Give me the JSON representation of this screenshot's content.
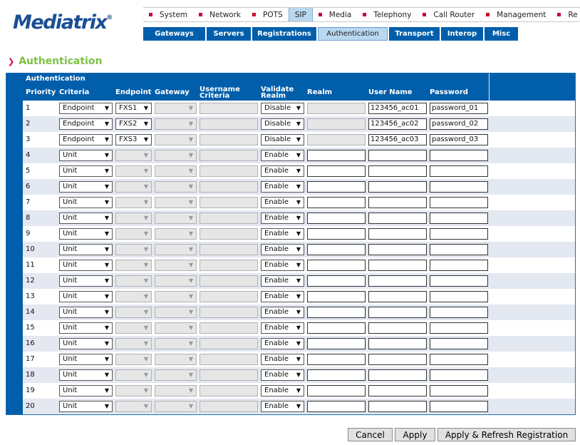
{
  "logo": {
    "name": "Mediatrix",
    "mark": "®"
  },
  "topnav": [
    {
      "label": "System",
      "active": false
    },
    {
      "label": "Network",
      "active": false
    },
    {
      "label": "POTS",
      "active": false
    },
    {
      "label": "SIP",
      "active": true
    },
    {
      "label": "Media",
      "active": false
    },
    {
      "label": "Telephony",
      "active": false
    },
    {
      "label": "Call Router",
      "active": false
    },
    {
      "label": "Management",
      "active": false
    },
    {
      "label": "Re",
      "active": false
    }
  ],
  "subnav": [
    {
      "label": "Gateways",
      "active": false
    },
    {
      "label": "Servers",
      "active": false
    },
    {
      "label": "Registrations",
      "active": false
    },
    {
      "label": "Authentication",
      "active": true
    },
    {
      "label": "Transport",
      "active": false
    },
    {
      "label": "Interop",
      "active": false
    },
    {
      "label": "Misc",
      "active": false
    }
  ],
  "page_title": "Authentication",
  "table": {
    "group_label": "Authentication",
    "columns": {
      "priority": "Priority",
      "criteria": "Criteria",
      "endpoint": "Endpoint",
      "gateway": "Gateway",
      "username_criteria_1": "Username",
      "username_criteria_2": "Criteria",
      "validate_realm_1": "Validate",
      "validate_realm_2": "Realm",
      "realm": "Realm",
      "user_name": "User Name",
      "password": "Password"
    },
    "rows": [
      {
        "priority": "1",
        "criteria": "Endpoint",
        "endpoint": "FXS1",
        "gateway": "",
        "username_criteria": "",
        "validate_realm": "Disable",
        "realm": "",
        "user_name": "123456_ac01",
        "password": "password_01"
      },
      {
        "priority": "2",
        "criteria": "Endpoint",
        "endpoint": "FXS2",
        "gateway": "",
        "username_criteria": "",
        "validate_realm": "Disable",
        "realm": "",
        "user_name": "123456_ac02",
        "password": "password_02"
      },
      {
        "priority": "3",
        "criteria": "Endpoint",
        "endpoint": "FXS3",
        "gateway": "",
        "username_criteria": "",
        "validate_realm": "Disable",
        "realm": "",
        "user_name": "123456_ac03",
        "password": "password_03"
      },
      {
        "priority": "4",
        "criteria": "Unit",
        "endpoint": "",
        "gateway": "",
        "username_criteria": "",
        "validate_realm": "Enable",
        "realm": "",
        "user_name": "",
        "password": ""
      },
      {
        "priority": "5",
        "criteria": "Unit",
        "endpoint": "",
        "gateway": "",
        "username_criteria": "",
        "validate_realm": "Enable",
        "realm": "",
        "user_name": "",
        "password": ""
      },
      {
        "priority": "6",
        "criteria": "Unit",
        "endpoint": "",
        "gateway": "",
        "username_criteria": "",
        "validate_realm": "Enable",
        "realm": "",
        "user_name": "",
        "password": ""
      },
      {
        "priority": "7",
        "criteria": "Unit",
        "endpoint": "",
        "gateway": "",
        "username_criteria": "",
        "validate_realm": "Enable",
        "realm": "",
        "user_name": "",
        "password": ""
      },
      {
        "priority": "8",
        "criteria": "Unit",
        "endpoint": "",
        "gateway": "",
        "username_criteria": "",
        "validate_realm": "Enable",
        "realm": "",
        "user_name": "",
        "password": ""
      },
      {
        "priority": "9",
        "criteria": "Unit",
        "endpoint": "",
        "gateway": "",
        "username_criteria": "",
        "validate_realm": "Enable",
        "realm": "",
        "user_name": "",
        "password": ""
      },
      {
        "priority": "10",
        "criteria": "Unit",
        "endpoint": "",
        "gateway": "",
        "username_criteria": "",
        "validate_realm": "Enable",
        "realm": "",
        "user_name": "",
        "password": ""
      },
      {
        "priority": "11",
        "criteria": "Unit",
        "endpoint": "",
        "gateway": "",
        "username_criteria": "",
        "validate_realm": "Enable",
        "realm": "",
        "user_name": "",
        "password": ""
      },
      {
        "priority": "12",
        "criteria": "Unit",
        "endpoint": "",
        "gateway": "",
        "username_criteria": "",
        "validate_realm": "Enable",
        "realm": "",
        "user_name": "",
        "password": ""
      },
      {
        "priority": "13",
        "criteria": "Unit",
        "endpoint": "",
        "gateway": "",
        "username_criteria": "",
        "validate_realm": "Enable",
        "realm": "",
        "user_name": "",
        "password": ""
      },
      {
        "priority": "14",
        "criteria": "Unit",
        "endpoint": "",
        "gateway": "",
        "username_criteria": "",
        "validate_realm": "Enable",
        "realm": "",
        "user_name": "",
        "password": ""
      },
      {
        "priority": "15",
        "criteria": "Unit",
        "endpoint": "",
        "gateway": "",
        "username_criteria": "",
        "validate_realm": "Enable",
        "realm": "",
        "user_name": "",
        "password": ""
      },
      {
        "priority": "16",
        "criteria": "Unit",
        "endpoint": "",
        "gateway": "",
        "username_criteria": "",
        "validate_realm": "Enable",
        "realm": "",
        "user_name": "",
        "password": ""
      },
      {
        "priority": "17",
        "criteria": "Unit",
        "endpoint": "",
        "gateway": "",
        "username_criteria": "",
        "validate_realm": "Enable",
        "realm": "",
        "user_name": "",
        "password": ""
      },
      {
        "priority": "18",
        "criteria": "Unit",
        "endpoint": "",
        "gateway": "",
        "username_criteria": "",
        "validate_realm": "Enable",
        "realm": "",
        "user_name": "",
        "password": ""
      },
      {
        "priority": "19",
        "criteria": "Unit",
        "endpoint": "",
        "gateway": "",
        "username_criteria": "",
        "validate_realm": "Enable",
        "realm": "",
        "user_name": "",
        "password": ""
      },
      {
        "priority": "20",
        "criteria": "Unit",
        "endpoint": "",
        "gateway": "",
        "username_criteria": "",
        "validate_realm": "Enable",
        "realm": "",
        "user_name": "",
        "password": ""
      }
    ]
  },
  "buttons": {
    "cancel": "Cancel",
    "apply": "Apply",
    "apply_refresh": "Apply & Refresh Registration"
  },
  "colors": {
    "brand_blue": "#005eaa",
    "nav_bullet": "#cc0033",
    "title_green": "#7cc242",
    "active_tab": "#b9d8f0",
    "row_alt": "#e3e8f1"
  },
  "icons": {
    "dropdown": "chevron-down-icon",
    "heading_marker": "arrow-right-icon"
  }
}
